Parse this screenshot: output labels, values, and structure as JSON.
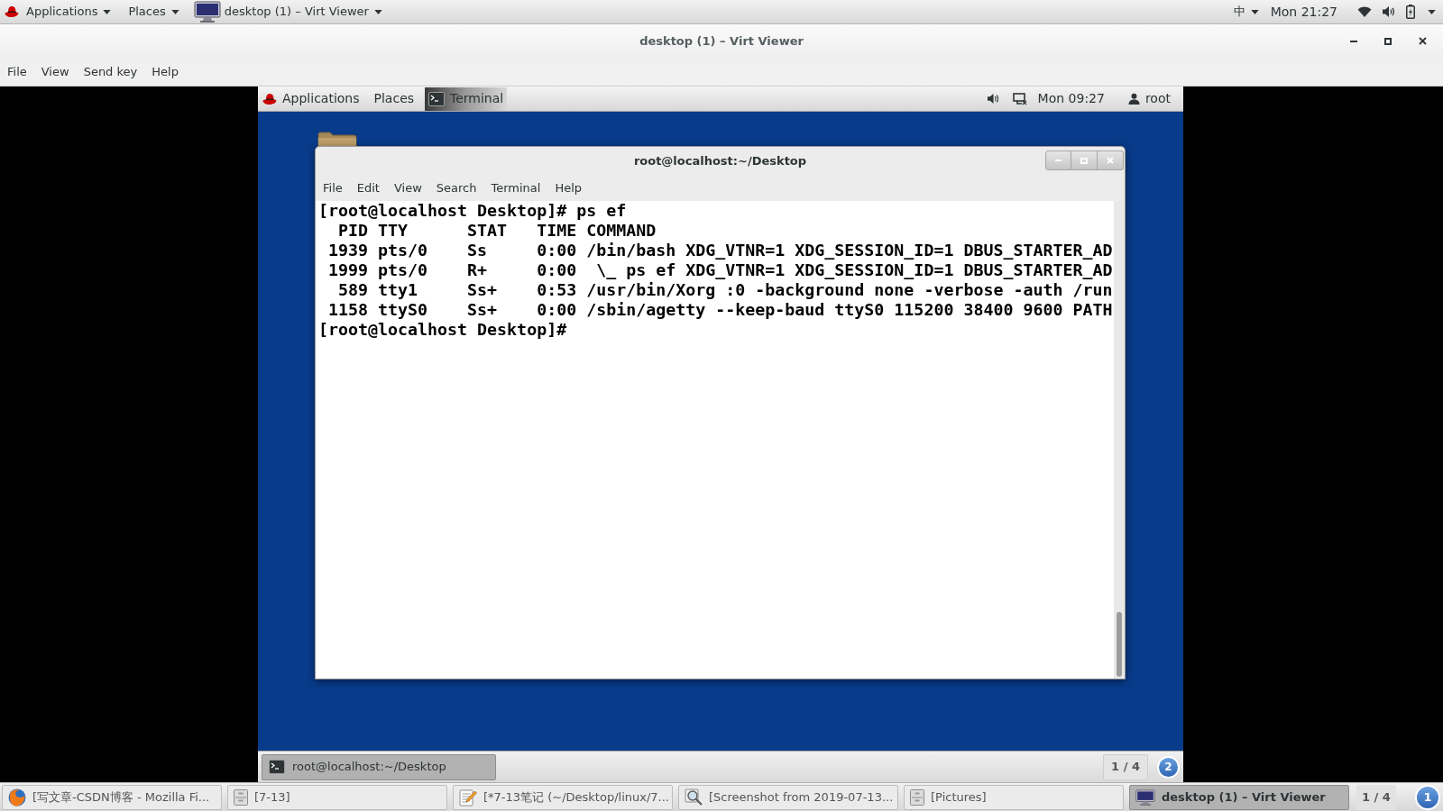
{
  "top_bar": {
    "menus": [
      "Applications",
      "Places"
    ],
    "active_window": "desktop (1) – Virt Viewer",
    "input_method": "中",
    "clock": "Mon 21:27"
  },
  "window": {
    "title": "desktop (1) – Virt Viewer",
    "menu": [
      "File",
      "View",
      "Send key",
      "Help"
    ]
  },
  "guest": {
    "top_bar": {
      "menus": [
        "Applications",
        "Places"
      ],
      "active_app": "Terminal",
      "clock": "Mon 09:27",
      "user": "root"
    },
    "terminal": {
      "title": "root@localhost:~/Desktop",
      "menu": [
        "File",
        "Edit",
        "View",
        "Search",
        "Terminal",
        "Help"
      ],
      "lines": [
        "[root@localhost Desktop]# ps ef",
        "  PID TTY      STAT   TIME COMMAND",
        " 1939 pts/0    Ss     0:00 /bin/bash XDG_VTNR=1 XDG_SESSION_ID=1 DBUS_STARTER_AD",
        " 1999 pts/0    R+     0:00  \\_ ps ef XDG_VTNR=1 XDG_SESSION_ID=1 DBUS_STARTER_AD",
        "  589 tty1     Ss+    0:53 /usr/bin/Xorg :0 -background none -verbose -auth /run",
        " 1158 ttyS0    Ss+    0:00 /sbin/agetty --keep-baud ttyS0 115200 38400 9600 PATH",
        "[root@localhost Desktop]#"
      ]
    },
    "bottom_bar": {
      "tasks": [
        {
          "kind": "terminal",
          "label": "root@localhost:~/Desktop",
          "selected": true
        }
      ],
      "workspace": "1 / 4",
      "badge": "2"
    }
  },
  "taskbar": {
    "tasks": [
      {
        "kind": "browser",
        "label": "[写文章-CSDN博客 - Mozilla Fi...",
        "selected": false
      },
      {
        "kind": "files",
        "label": "[7-13]",
        "selected": false
      },
      {
        "kind": "editor",
        "label": "[*7-13笔记 (~/Desktop/linux/7...",
        "selected": false
      },
      {
        "kind": "image-viewer",
        "label": "[Screenshot from 2019-07-13...",
        "selected": false
      },
      {
        "kind": "files",
        "label": "[Pictures]",
        "selected": false
      },
      {
        "kind": "display",
        "label": "desktop (1) – Virt Viewer",
        "selected": true
      }
    ],
    "workspace": "1 / 4",
    "badge": "1"
  }
}
